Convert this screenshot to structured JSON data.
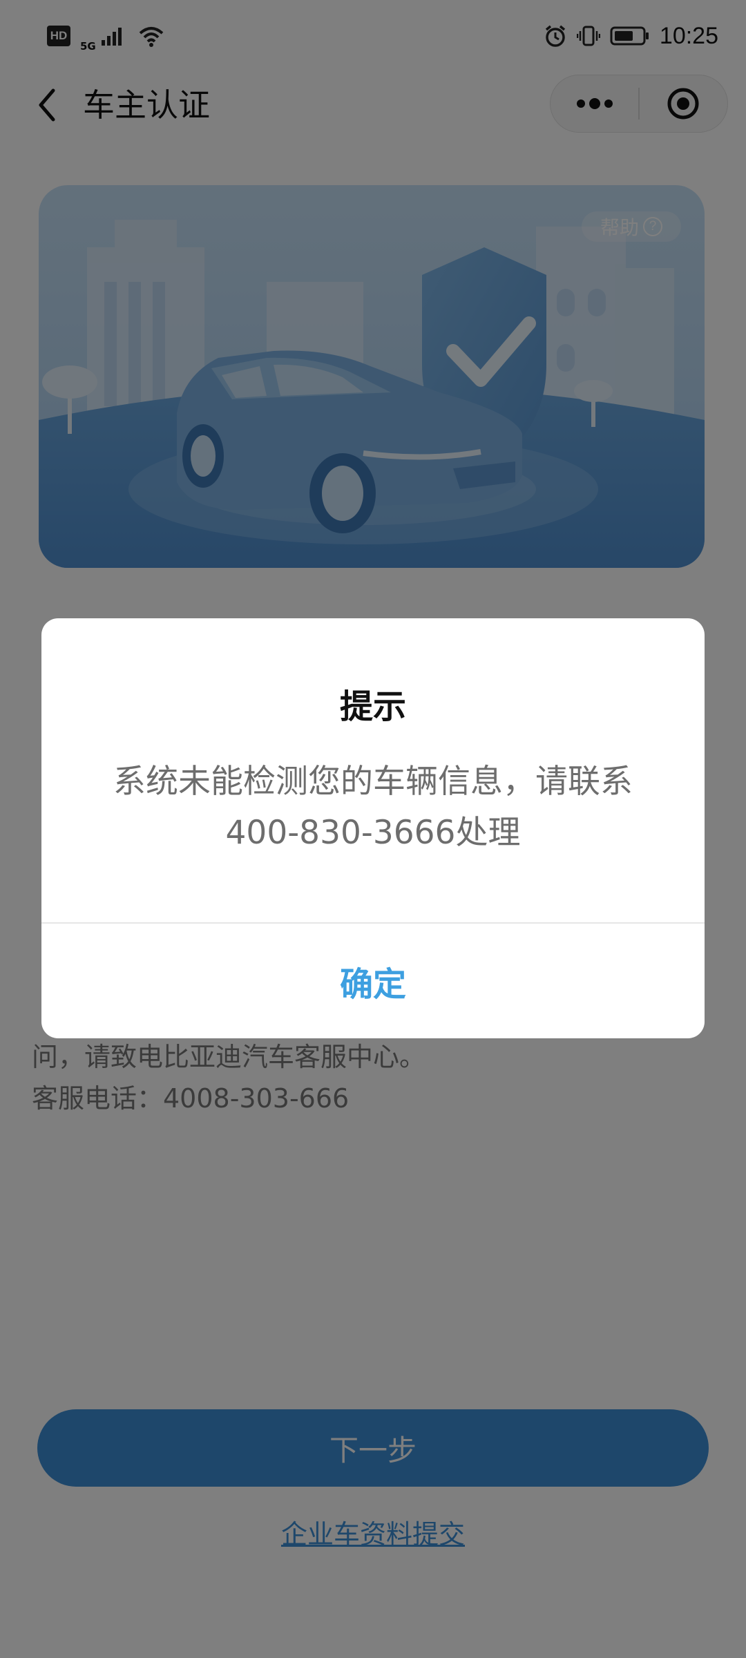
{
  "status_bar": {
    "hd_badge": "HD",
    "network_label": "5G",
    "time": "10:25",
    "icons": [
      "hd-icon",
      "signal-icon",
      "wifi-icon",
      "alarm-icon",
      "vibrate-icon",
      "battery-icon"
    ]
  },
  "nav": {
    "title": "车主认证",
    "back_icon": "chevron-left-icon",
    "more_icon": "more-dots-icon",
    "close_icon": "target-close-icon"
  },
  "banner": {
    "help_label": "帮助",
    "help_icon": "question-circle-icon",
    "illustration": "car-with-shield-checkmark"
  },
  "background": {
    "info_text_line1": "问，请致电比亚迪汽车客服中心。",
    "info_text_line2": "客服电话：4008-303-666",
    "next_button": "下一步",
    "enterprise_link": "企业车资料提交"
  },
  "dialog": {
    "title": "提示",
    "message": "系统未能检测您的车辆信息，请联系400-830-3666处理",
    "confirm": "确定"
  },
  "colors": {
    "accent": "#3d9fe0",
    "primary_button": "#3d8fd6",
    "overlay": "rgba(0,0,0,0.5)"
  }
}
